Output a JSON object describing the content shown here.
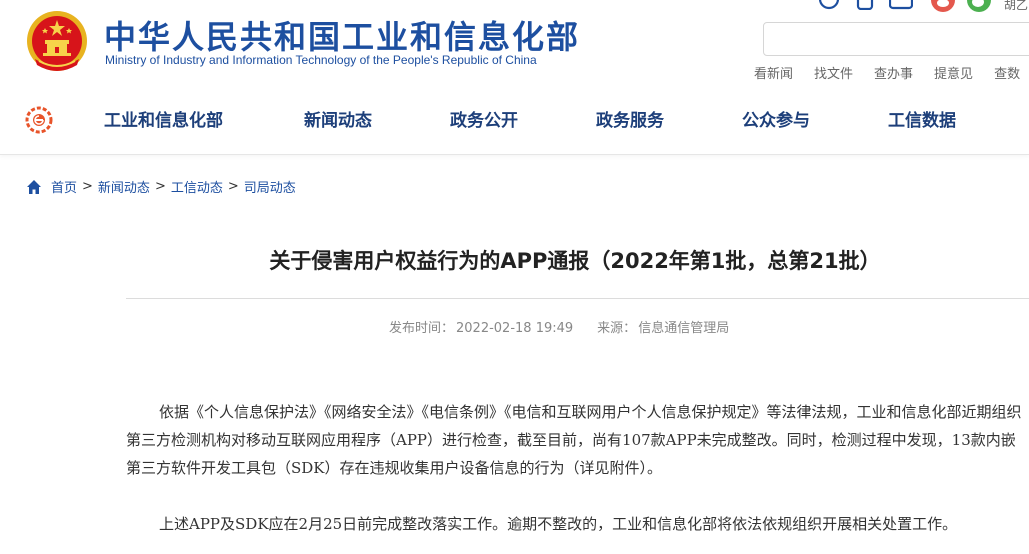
{
  "header": {
    "title": "中华人民共和国工业和信息化部",
    "subtitle": "Ministry of Industry and Information Technology of the People's Republic of China",
    "top_extra_text": "胡乙",
    "search_placeholder": "",
    "quick_links": [
      "看新闻",
      "找文件",
      "查办事",
      "提意见",
      "查数"
    ]
  },
  "nav": {
    "items": [
      "工业和信息化部",
      "新闻动态",
      "政务公开",
      "政务服务",
      "公众参与",
      "工信数据"
    ]
  },
  "breadcrumb": {
    "items": [
      "首页",
      "新闻动态",
      "工信动态",
      "司局动态"
    ],
    "separator": ">"
  },
  "article": {
    "title": "关于侵害用户权益行为的APP通报（2022年第1批，总第21批）",
    "publish_label": "发布时间：",
    "publish_time": "2022-02-18 19:49",
    "source_label": "来源：",
    "source": "信息通信管理局",
    "paragraphs": [
      "依据《个人信息保护法》《网络安全法》《电信条例》《电信和互联网用户个人信息保护规定》等法律法规，工业和信息化部近期组织第三方检测机构对移动互联网应用程序（APP）进行检查，截至目前，尚有107款APP未完成整改。同时，检测过程中发现，13款内嵌第三方软件开发工具包（SDK）存在违规收集用户设备信息的行为（详见附件）。",
      "上述APP及SDK应在2月25日前完成整改落实工作。逾期不整改的，工业和信息化部将依法依规组织开展相关处置工作。"
    ]
  },
  "colors": {
    "brand_blue": "#1d4fa0",
    "nav_text": "#1d3f7a",
    "emblem_red": "#d7141a",
    "emblem_gold": "#f2c230"
  }
}
